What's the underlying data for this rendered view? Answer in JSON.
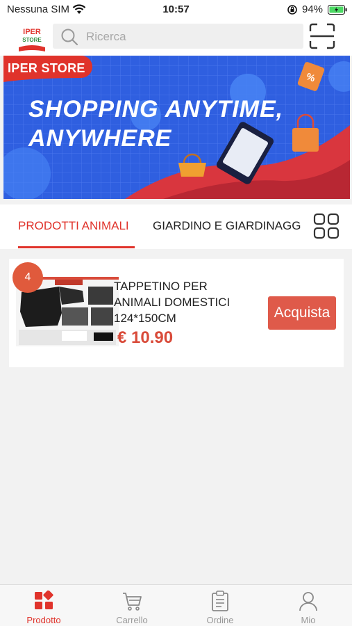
{
  "status_bar": {
    "carrier": "Nessuna SIM",
    "time": "10:57",
    "battery": "94%"
  },
  "header": {
    "logo_text_top": "IPER",
    "logo_text_bottom": "STORE",
    "search_placeholder": "Ricerca"
  },
  "banner": {
    "brand": "IPER STORE",
    "slogan_line1": "SHOPPING ANYTIME,",
    "slogan_line2": "ANYWHERE"
  },
  "tabs": {
    "items": [
      {
        "label": "PRODOTTI ANIMALI",
        "active": true
      },
      {
        "label": "GIARDINO E GIARDINAGGIO",
        "active": false
      }
    ]
  },
  "products": [
    {
      "badge": "4",
      "name": "TAPPETINO PER ANIMALI DOMESTICI 124*150CM",
      "price": "€ 10.90",
      "buy_label": "Acquista"
    }
  ],
  "bottom_nav": {
    "items": [
      {
        "label": "Prodotto",
        "icon": "grid-icon",
        "active": true
      },
      {
        "label": "Carrello",
        "icon": "cart-icon",
        "active": false
      },
      {
        "label": "Ordine",
        "icon": "clipboard-icon",
        "active": false
      },
      {
        "label": "Mio",
        "icon": "user-icon",
        "active": false
      }
    ]
  },
  "colors": {
    "accent": "#e0332b",
    "price": "#d94b3a",
    "buy_button": "#df5a4a",
    "banner_blue": "#2f5fe0"
  }
}
